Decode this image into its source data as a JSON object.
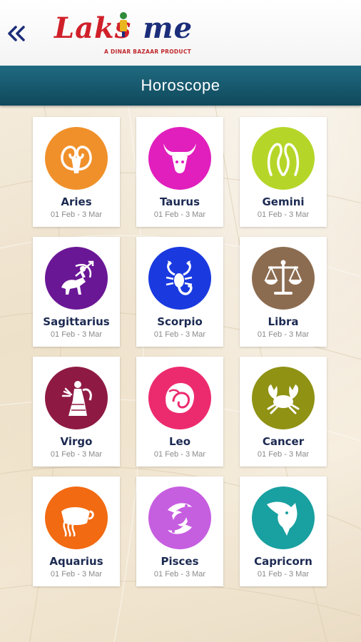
{
  "header": {
    "back_icon": "double-chevron-left-icon",
    "logo_text_part1": "Laks",
    "logo_text_part2": "me",
    "logo_tagline": "A DINAR BAZAAR PRODUCT"
  },
  "title_bar": {
    "title": "Horoscope",
    "color": "#16586d"
  },
  "signs": [
    {
      "name": "Aries",
      "dates": "01 Feb - 3 Mar",
      "color": "#f0902a",
      "icon": "ram-icon"
    },
    {
      "name": "Taurus",
      "dates": "01 Feb - 3 Mar",
      "color": "#e11fbd",
      "icon": "bull-icon"
    },
    {
      "name": "Gemini",
      "dates": "01 Feb - 3 Mar",
      "color": "#b5d628",
      "icon": "twins-icon"
    },
    {
      "name": "Sagittarius",
      "dates": "01 Feb - 3 Mar",
      "color": "#6a1796",
      "icon": "archer-icon"
    },
    {
      "name": "Scorpio",
      "dates": "01 Feb - 3 Mar",
      "color": "#1a3adf",
      "icon": "scorpion-icon"
    },
    {
      "name": "Libra",
      "dates": "01 Feb - 3 Mar",
      "color": "#8c6c50",
      "icon": "scales-icon"
    },
    {
      "name": "Virgo",
      "dates": "01 Feb - 3 Mar",
      "color": "#8e1a44",
      "icon": "maiden-icon"
    },
    {
      "name": "Leo",
      "dates": "01 Feb - 3 Mar",
      "color": "#ec2b6f",
      "icon": "lion-icon"
    },
    {
      "name": "Cancer",
      "dates": "01 Feb - 3 Mar",
      "color": "#8f9213",
      "icon": "crab-icon"
    },
    {
      "name": "Aquarius",
      "dates": "01 Feb - 3 Mar",
      "color": "#f26a12",
      "icon": "water-bearer-icon"
    },
    {
      "name": "Pisces",
      "dates": "01 Feb - 3 Mar",
      "color": "#c65ee0",
      "icon": "fish-icon"
    },
    {
      "name": "Capricorn",
      "dates": "01 Feb - 3 Mar",
      "color": "#19a0a0",
      "icon": "goat-icon"
    }
  ]
}
